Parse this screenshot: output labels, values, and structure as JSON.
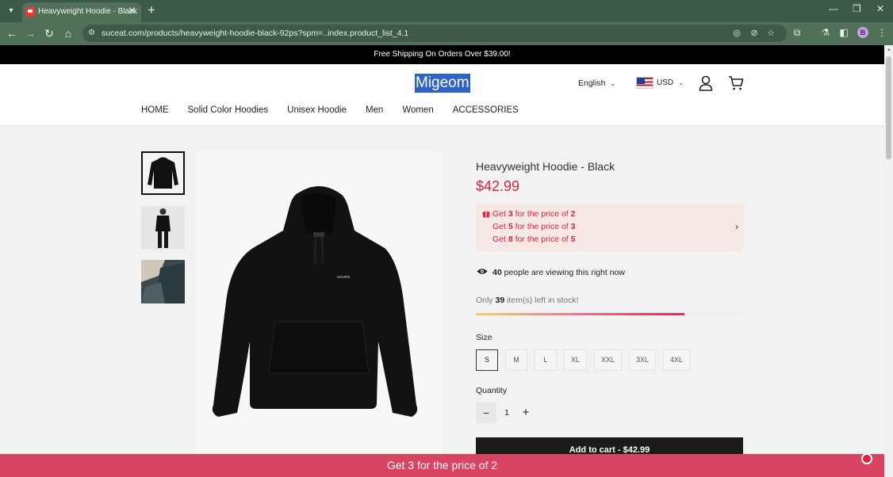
{
  "browser": {
    "tab_title": "Heavyweight Hoodie - Black",
    "tab_close": "✕",
    "new_tab": "+",
    "url": "suceat.com/products/heavyweight-hoodie-black-92ps?spm=..index.product_list_4.1",
    "profile_initial": "B"
  },
  "store": {
    "announcement": "Free Shipping On Orders Over $39.00!",
    "logo": "Migeom",
    "language": "English",
    "currency": "USD",
    "nav": [
      "HOME",
      "Solid Color Hoodies",
      "Unisex Hoodie",
      "Men",
      "Women",
      "ACCESSORIES"
    ]
  },
  "product": {
    "title": "Heavyweight Hoodie - Black",
    "price": "$42.99",
    "promos": [
      {
        "prefix": "Get ",
        "qty": "3",
        "mid": " for the price of ",
        "pay": "2"
      },
      {
        "prefix": "Get ",
        "qty": "5",
        "mid": " for the price of ",
        "pay": "3"
      },
      {
        "prefix": "Get ",
        "qty": "8",
        "mid": " for the price of ",
        "pay": "5"
      }
    ],
    "viewers_count": "40",
    "viewers_text": " people are viewing this right now",
    "stock_prefix": "Only ",
    "stock_count": "39",
    "stock_suffix": " item(s) left in stock!",
    "stock_fraction": 0.78,
    "size_label": "Size",
    "sizes": [
      "S",
      "M",
      "L",
      "XL",
      "XXL",
      "3XL",
      "4XL"
    ],
    "selected_size": "S",
    "quantity_label": "Quantity",
    "quantity": "1",
    "minus": "−",
    "plus": "+",
    "add_to_cart": "Add to cart - $42.99",
    "hoodie_print": "HOURS"
  },
  "bottom_bar": {
    "text": "Get 3 for the price of 2"
  },
  "colors": {
    "chrome": "#51705a",
    "accent_red": "#e0203c",
    "bottom_bar": "#d94463",
    "logo_highlight": "#2e63c7"
  }
}
